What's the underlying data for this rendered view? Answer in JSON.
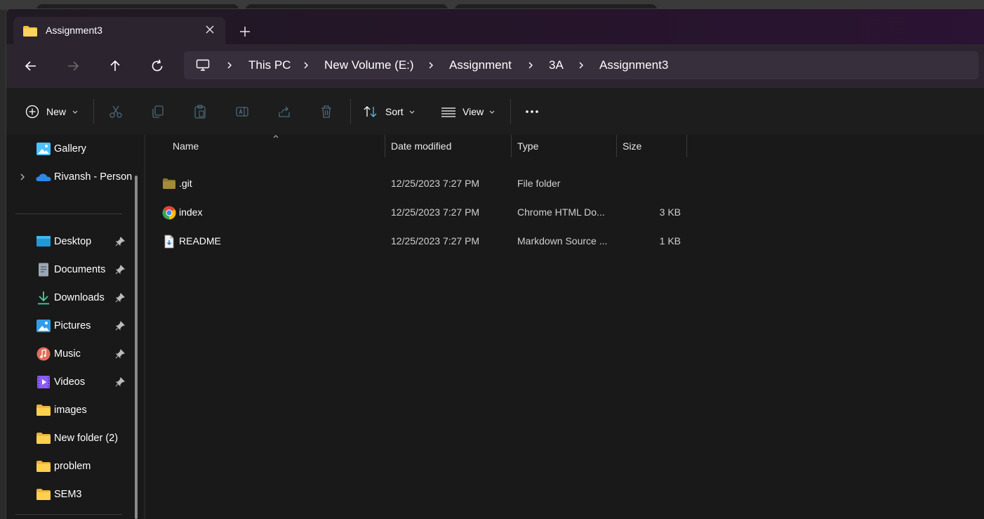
{
  "tab": {
    "title": "Assignment3"
  },
  "breadcrumb": [
    "This PC",
    "New Volume (E:)",
    "Assignment",
    "3A",
    "Assignment3"
  ],
  "toolbar": {
    "new_label": "New",
    "sort_label": "Sort",
    "view_label": "View"
  },
  "sidebar": {
    "top": [
      {
        "label": "Gallery",
        "icon": "gallery-icon"
      },
      {
        "label": "Rivansh - Person",
        "icon": "onedrive-icon"
      }
    ],
    "quick": [
      {
        "label": "Desktop",
        "icon": "desktop-icon",
        "pinned": true
      },
      {
        "label": "Documents",
        "icon": "documents-icon",
        "pinned": true
      },
      {
        "label": "Downloads",
        "icon": "downloads-icon",
        "pinned": true
      },
      {
        "label": "Pictures",
        "icon": "pictures-icon",
        "pinned": true
      },
      {
        "label": "Music",
        "icon": "music-icon",
        "pinned": true
      },
      {
        "label": "Videos",
        "icon": "videos-icon",
        "pinned": true
      },
      {
        "label": "images",
        "icon": "folder-icon",
        "pinned": false
      },
      {
        "label": "New folder (2)",
        "icon": "folder-icon",
        "pinned": false
      },
      {
        "label": "problem",
        "icon": "folder-icon",
        "pinned": false
      },
      {
        "label": "SEM3",
        "icon": "folder-icon",
        "pinned": false
      }
    ]
  },
  "columns": {
    "name": "Name",
    "date": "Date modified",
    "type": "Type",
    "size": "Size"
  },
  "files": [
    {
      "name": ".git",
      "date": "12/25/2023 7:27 PM",
      "type": "File folder",
      "size": "",
      "icon": "folder-icon"
    },
    {
      "name": "index",
      "date": "12/25/2023 7:27 PM",
      "type": "Chrome HTML Do...",
      "size": "3 KB",
      "icon": "chrome-icon"
    },
    {
      "name": "README",
      "date": "12/25/2023 7:27 PM",
      "type": "Markdown Source ...",
      "size": "1 KB",
      "icon": "markdown-file-icon"
    }
  ],
  "colors": {
    "folder": "#f5c244",
    "accent": "#4cc2ff",
    "window_bg": "#191919"
  }
}
